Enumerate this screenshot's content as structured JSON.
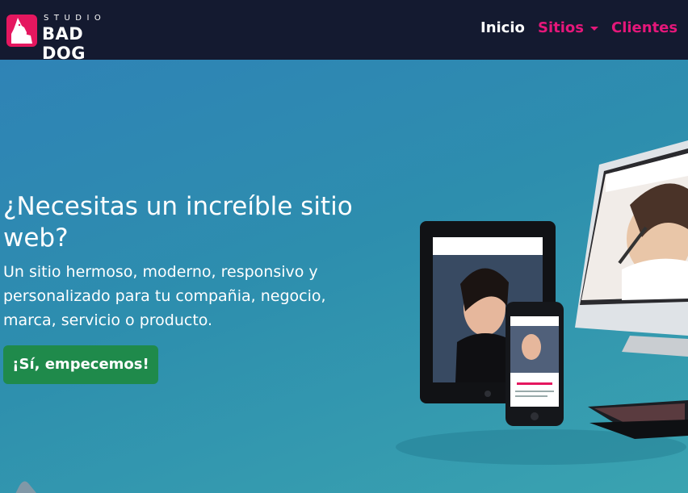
{
  "brand": {
    "studio": "STUDIO",
    "name": "BAD DOG",
    "color": "#e5175f",
    "icon": "dog-icon"
  },
  "nav": {
    "inicio": "Inicio",
    "sitios": "Sitios",
    "clientes": "Clientes",
    "caret_icon": "caret-down-icon",
    "active_color": "#ffffff",
    "accent_color": "#e5177a"
  },
  "hero": {
    "title": "¿Necesitas un increíble sitio web?",
    "subtitle": "Un sitio hermoso, moderno, responsivo y personalizado para tu compañia, negocio, marca, servicio o producto.",
    "cta_label": "¡Sí, empecemos!",
    "cta_color": "#1f8a4b"
  },
  "devices_image": {
    "alt": "devices-mockup"
  }
}
